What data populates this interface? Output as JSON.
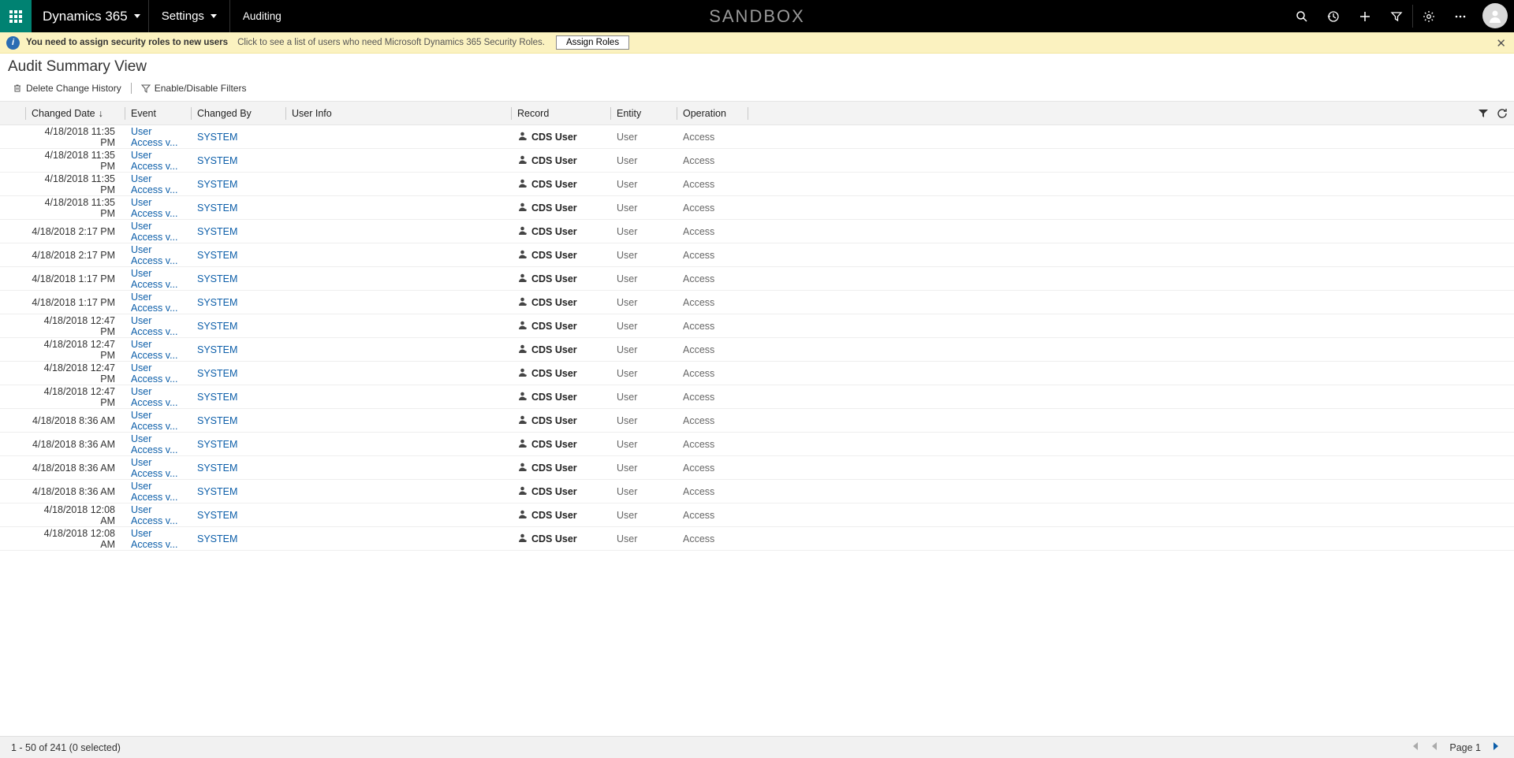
{
  "topbar": {
    "brand": "Dynamics 365",
    "settings": "Settings",
    "auditing": "Auditing",
    "sandbox": "SANDBOX"
  },
  "notif": {
    "bold": "You need to assign security roles to new users",
    "sub": "Click to see a list of users who need Microsoft Dynamics 365 Security Roles.",
    "button": "Assign Roles"
  },
  "page_title": "Audit Summary View",
  "tools": {
    "delete": "Delete Change History",
    "filters": "Enable/Disable Filters"
  },
  "columns": {
    "date": "Changed Date",
    "event": "Event",
    "chby": "Changed By",
    "uinfo": "User Info",
    "record": "Record",
    "entity": "Entity",
    "operation": "Operation"
  },
  "event_label": "User Access v...",
  "system_label": "SYSTEM",
  "record_label": "CDS User",
  "entity_label": "User",
  "op_label": "Access",
  "rows": [
    {
      "date": "4/18/2018 11:35 PM"
    },
    {
      "date": "4/18/2018 11:35 PM"
    },
    {
      "date": "4/18/2018 11:35 PM"
    },
    {
      "date": "4/18/2018 11:35 PM"
    },
    {
      "date": "4/18/2018 2:17 PM"
    },
    {
      "date": "4/18/2018 2:17 PM"
    },
    {
      "date": "4/18/2018 1:17 PM"
    },
    {
      "date": "4/18/2018 1:17 PM"
    },
    {
      "date": "4/18/2018 12:47 PM"
    },
    {
      "date": "4/18/2018 12:47 PM"
    },
    {
      "date": "4/18/2018 12:47 PM"
    },
    {
      "date": "4/18/2018 12:47 PM"
    },
    {
      "date": "4/18/2018 8:36 AM"
    },
    {
      "date": "4/18/2018 8:36 AM"
    },
    {
      "date": "4/18/2018 8:36 AM"
    },
    {
      "date": "4/18/2018 8:36 AM"
    },
    {
      "date": "4/18/2018 12:08 AM"
    },
    {
      "date": "4/18/2018 12:08 AM"
    }
  ],
  "footer": {
    "count": "1 - 50 of 241 (0 selected)",
    "page": "Page 1"
  }
}
